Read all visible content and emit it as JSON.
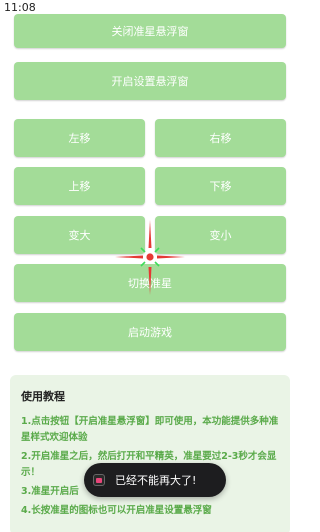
{
  "status_bar": {
    "time": "11:08"
  },
  "buttons": {
    "close_float": "关闭准星悬浮窗",
    "open_settings_float": "开启设置悬浮窗",
    "move_left": "左移",
    "move_right": "右移",
    "move_up": "上移",
    "move_down": "下移",
    "bigger": "变大",
    "smaller": "变小",
    "switch_crosshair": "切换准星",
    "start_game": "启动游戏"
  },
  "tutorial": {
    "title": "使用教程",
    "steps": [
      "1.点击按钮【开启准星悬浮窗】即可使用，本功能提供多种准星样式欢迎体验",
      "2.开启准星之后，然后打开和平精英，准星要过2-3秒才会显示！",
      "3.准星开启后",
      "4.长按准星的图标也可以开启准星设置悬浮窗"
    ]
  },
  "toast": {
    "text": "已经不能再大了!"
  },
  "colors": {
    "button_green": "#a3dc98",
    "crosshair_red": "#e53935",
    "crosshair_green": "#3ddc5a",
    "tutorial_bg": "#eaf4e6",
    "tutorial_text": "#5aaa4a"
  }
}
